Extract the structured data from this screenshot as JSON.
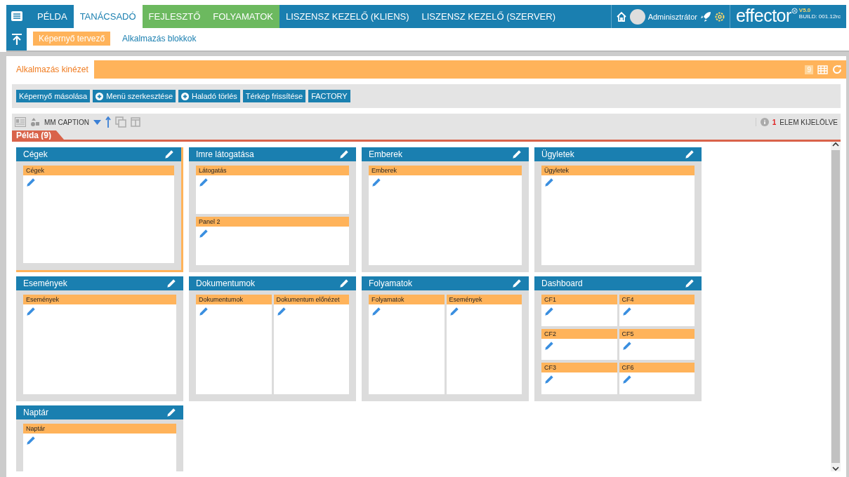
{
  "top_nav": {
    "tabs": [
      {
        "label": "PÉLDA",
        "selected": false,
        "color": "#1a7fb0"
      },
      {
        "label": "TANÁCSADÓ",
        "selected": true,
        "color": "#1a7fb0"
      },
      {
        "label": "FEJLESZTŐ",
        "selected": false,
        "color": "#6cb95f"
      },
      {
        "label": "FOLYAMATOK",
        "selected": false,
        "color": "#6cb95f"
      },
      {
        "label": "LISZENSZ KEZELŐ (KLIENS)",
        "selected": false,
        "color": "#1a7fb0"
      },
      {
        "label": "LISZENSZ KEZELŐ (SZERVER)",
        "selected": false,
        "color": "#1a7fb0"
      }
    ],
    "user": "Adminisztrátor",
    "logo": "effector",
    "version": "V5.0",
    "build": "BUILD: 001.12rc"
  },
  "sub_nav": [
    {
      "label": "Képernyő tervező",
      "selected": true
    },
    {
      "label": "Alkalmazás blokkok",
      "selected": false
    }
  ],
  "page_tab": {
    "label": "Alkalmazás kinézet",
    "badge": "9"
  },
  "actions": [
    {
      "label": "Képernyő másolása",
      "kind": "plain"
    },
    {
      "label": "Menü szerkesztése",
      "kind": "add"
    },
    {
      "label": "Haladó törlés",
      "kind": "add"
    },
    {
      "label": "Térkép frissítése",
      "kind": "plain"
    },
    {
      "label": "FACTORY",
      "kind": "plain"
    }
  ],
  "toolbar": {
    "caption": "MM CAPTION",
    "selected_count": "1",
    "selected_label": "ELEM KIJELÖLVE"
  },
  "section": {
    "title": "Példa (9)"
  },
  "cards": [
    {
      "title": "Cégek",
      "selected": true,
      "columns": [
        [
          "Cégek"
        ]
      ]
    },
    {
      "title": "Imre látogatása",
      "selected": false,
      "columns": [
        [
          "Látogatás",
          "Panel 2"
        ]
      ]
    },
    {
      "title": "Emberek",
      "selected": false,
      "columns": [
        [
          "Emberek"
        ]
      ]
    },
    {
      "title": "Ügyletek",
      "selected": false,
      "columns": [
        [
          "Ügyletek"
        ]
      ]
    },
    {
      "title": "Események",
      "selected": false,
      "columns": [
        [
          "Események"
        ]
      ]
    },
    {
      "title": "Dokumentumok",
      "selected": false,
      "columns": [
        [
          "Dokumentumok"
        ],
        [
          "Dokumentum előnézet"
        ]
      ]
    },
    {
      "title": "Folyamatok",
      "selected": false,
      "columns": [
        [
          "Folyamatok"
        ],
        [
          "Események"
        ]
      ]
    },
    {
      "title": "Dashboard",
      "selected": false,
      "columns": [
        [
          "CF1",
          "CF2",
          "CF3"
        ],
        [
          "CF4",
          "CF5",
          "CF6"
        ]
      ]
    },
    {
      "title": "Naptár",
      "selected": false,
      "columns": [
        [
          "Naptár"
        ]
      ]
    }
  ]
}
